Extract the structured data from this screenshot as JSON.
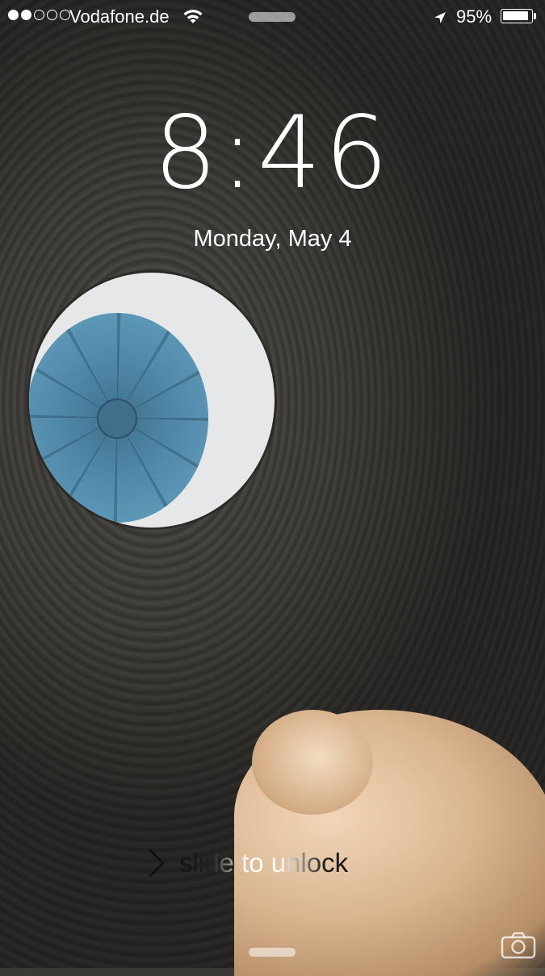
{
  "status_bar": {
    "signal_total": 5,
    "signal_filled": 2,
    "carrier": "Vodafone.de",
    "wifi_icon": "wifi-icon",
    "location_icon": "location-arrow-icon",
    "battery_percent_label": "95%",
    "battery_level": 0.95
  },
  "lock_screen": {
    "time": "8:46",
    "date": "Monday, May 4",
    "slide_to_unlock": "slide to unlock",
    "chevron_icon": "chevron-right-icon",
    "camera_icon": "camera-icon"
  },
  "colors": {
    "text": "#ffffff",
    "sky": "#e6e7e9",
    "dome_blue": "#4f87a8",
    "statue": "#d9b590"
  }
}
